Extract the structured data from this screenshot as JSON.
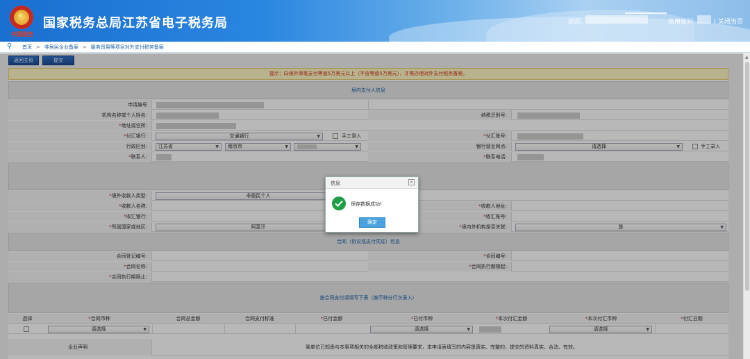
{
  "header": {
    "title": "国家税务总局江苏省电子税务局",
    "slogan": "中国税务",
    "welcome": "欢迎,",
    "level_label": "信用级别:",
    "close_link": "| 关闭当页"
  },
  "breadcrumb": {
    "items": [
      "首页",
      "非居民企业备案",
      "服务贸易等项目对外支付税务备案"
    ],
    "sep": ">"
  },
  "toolbar": {
    "back_label": "返回主页",
    "submit_label": "提交"
  },
  "form": {
    "hint": "提示：向境外单笔支付等值5万美元以上（不含等值5万美元），才需办理对外支付税务备案。",
    "sections": {
      "domestic": "境内支付人信息",
      "contract": "合同（协议或支付凭证）信息",
      "payment": "按合同支付请填写下表（按币种分行次录入）"
    },
    "domestic": {
      "apply_no_label": "申请编号",
      "org_name_label": "机构名称或个人姓名:",
      "taxpayer_id_label": "纳税识别号:",
      "address_label": "*地址或住所:",
      "bank_label": "*付汇银行:",
      "bank_value": "交通银行",
      "manual_label": "手工录入",
      "account_label": "*付汇账号:",
      "region_label": "行政区划:",
      "province": "江苏省",
      "city": "南京市",
      "branch_label": "银行营业网点:",
      "branch_value": "请选择",
      "contact_label": "*联系人:",
      "phone_label": "*联系电话:"
    },
    "overseas": {
      "type_label": "*境外收款人类型:",
      "type_value": "非居民个人",
      "payee_name_label": "*收款人名称:",
      "payee_addr_label": "*收款人地址:",
      "bank_label": "*收汇银行:",
      "account_label": "*收汇账号:",
      "country_label": "*所属国家或地区:",
      "country_value": "阿富汗",
      "related_label": "*境内外机构是否关联:",
      "related_value": "是"
    },
    "contract": {
      "reg_no_label": "合同登记编号:",
      "contract_no_label": "*合同编号:",
      "name_label": "*合同名称:",
      "exec_start_label": "*合同执行期限起:",
      "exec_end_label": "*合同执行期限止:"
    },
    "payment_table": {
      "columns": [
        "选择",
        "*合同币种",
        "合同总金额",
        "合同支付标准",
        "*已付金额",
        "*已付币种",
        "*本次付汇金额",
        "*本次付汇币种",
        "*付汇日期"
      ],
      "select_placeholder": "请选择"
    },
    "declaration": {
      "label": "企业声明",
      "text": "我单位已知悉与本事项相关的全部税收政策和管理要求，本申请表填写的内容是真实、完整的，提交的资料真实、合法、有效。"
    }
  },
  "dialog": {
    "title": "信息",
    "close": "×",
    "message": "保存数据成功!",
    "ok_label": "确定"
  },
  "colors": {
    "header_blue": "#1a6fd0",
    "hint_red": "#d2331e",
    "success_green": "#1f9d47",
    "ok_button": "#4aa3df"
  }
}
